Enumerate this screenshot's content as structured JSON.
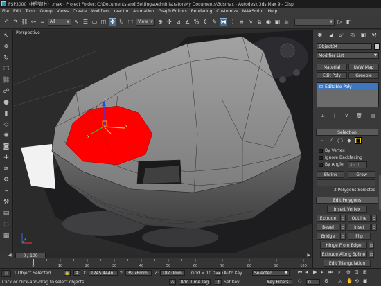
{
  "title": {
    "text": "PSP3000（模型部分）.max  - Project Folder: C:\\Documents and Settings\\Administrator\\My Documents\\3dsmax  - Autodesk 3ds Max 9   - Disp"
  },
  "menu": [
    "File",
    "Edit",
    "Tools",
    "Group",
    "Views",
    "Create",
    "Modifiers",
    "reactor",
    "Animation",
    "Graph Editors",
    "Rendering",
    "Customize",
    "MAXScript",
    "Help"
  ],
  "toolbar": {
    "selection_filter": "All",
    "ref_coord": "View",
    "named_sel": ""
  },
  "viewport": {
    "label": "Perspective"
  },
  "cmdpanel": {
    "object_name": "Object04",
    "modifier_list": "Modifier List",
    "buttons": {
      "material": "Material",
      "uvw_map": "UVW Map",
      "edit_poly": "Edit Poly",
      "greeble": "Greeble"
    },
    "stack_item": "Editable Poly",
    "selection": {
      "rollout": "Selection",
      "by_vertex": "By Vertex",
      "ignore_backfacing": "Ignore Backfacing",
      "by_angle": "By Angle:",
      "by_angle_value": "45.0",
      "shrink": "Shrink",
      "grow": "Grow",
      "status": "2 Polygons Selected"
    },
    "edit_polygons": {
      "rollout": "Edit Polygons",
      "insert_vertex": "Insert Vertex",
      "extrude": "Extrude",
      "outline": "Outline",
      "bevel": "Bevel",
      "inset": "Inset",
      "bridge": "Bridge",
      "flip": "Flip",
      "hinge_from_edge": "Hinge From Edge",
      "extrude_along_spline": "Extrude Along Spline",
      "edit_triangulation": "Edit Triangulation"
    }
  },
  "timeline": {
    "frame": "0 / 100",
    "ticks": [
      "0",
      "10",
      "20",
      "30",
      "40",
      "50",
      "60",
      "70",
      "80",
      "90",
      "100"
    ]
  },
  "status": {
    "objects_selected": "1 Object Selected",
    "prompt": "Click or click-and-drag to select objects",
    "x": "1245.444n",
    "y": "39.76mm",
    "z": "187.0mm",
    "grid": "Grid = 10.0mm",
    "auto_key": "Auto Key",
    "set_key": "Set Key",
    "key_mode": "Selected",
    "key_filters": "Key Filters...",
    "add_time_tag": "Add Time Tag",
    "frame_field": "0"
  },
  "colors": {
    "selected_poly": "#ff0000",
    "model_gray": "#8a8a8a",
    "accent_blue": "#3e76c0"
  }
}
